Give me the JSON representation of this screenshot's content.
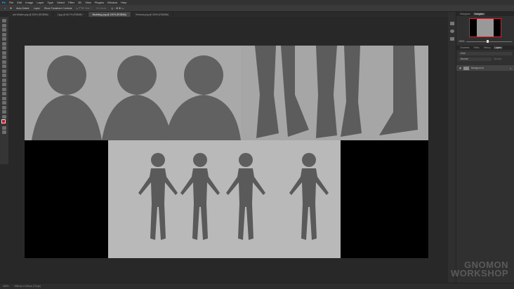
{
  "menu": [
    "File",
    "Edit",
    "Image",
    "Layer",
    "Type",
    "Select",
    "Filter",
    "3D",
    "View",
    "Plugins",
    "Window",
    "Help"
  ],
  "options": {
    "auto_select": "Auto-Select:",
    "layer": "Layer",
    "transform": "Show Transform Controls",
    "mode": "3D Mode:"
  },
  "tabs": [
    "ard Wolder.png @ 200% (RGB/8#)",
    "1.jpg @ 66.7% (RGB/8) *",
    "Modeling.png @ 100% (RGB/8#)",
    "Textures.png @ 200% (RGB/8#)"
  ],
  "panels": {
    "top_tabs": [
      "Histogram",
      "Navigator"
    ],
    "zoom": "100%",
    "layer_tabs": [
      "Channels",
      "Paths",
      "History",
      "Layers"
    ],
    "kind": "Kind",
    "blend": "Normal",
    "opacity": "Opacity:",
    "layer_name": "Background"
  },
  "status": {
    "zoom": "100%",
    "doc": "1954 px x 1146 px (72 ppi)"
  },
  "watermark": [
    "GNOMON",
    "WORKSHOP"
  ]
}
